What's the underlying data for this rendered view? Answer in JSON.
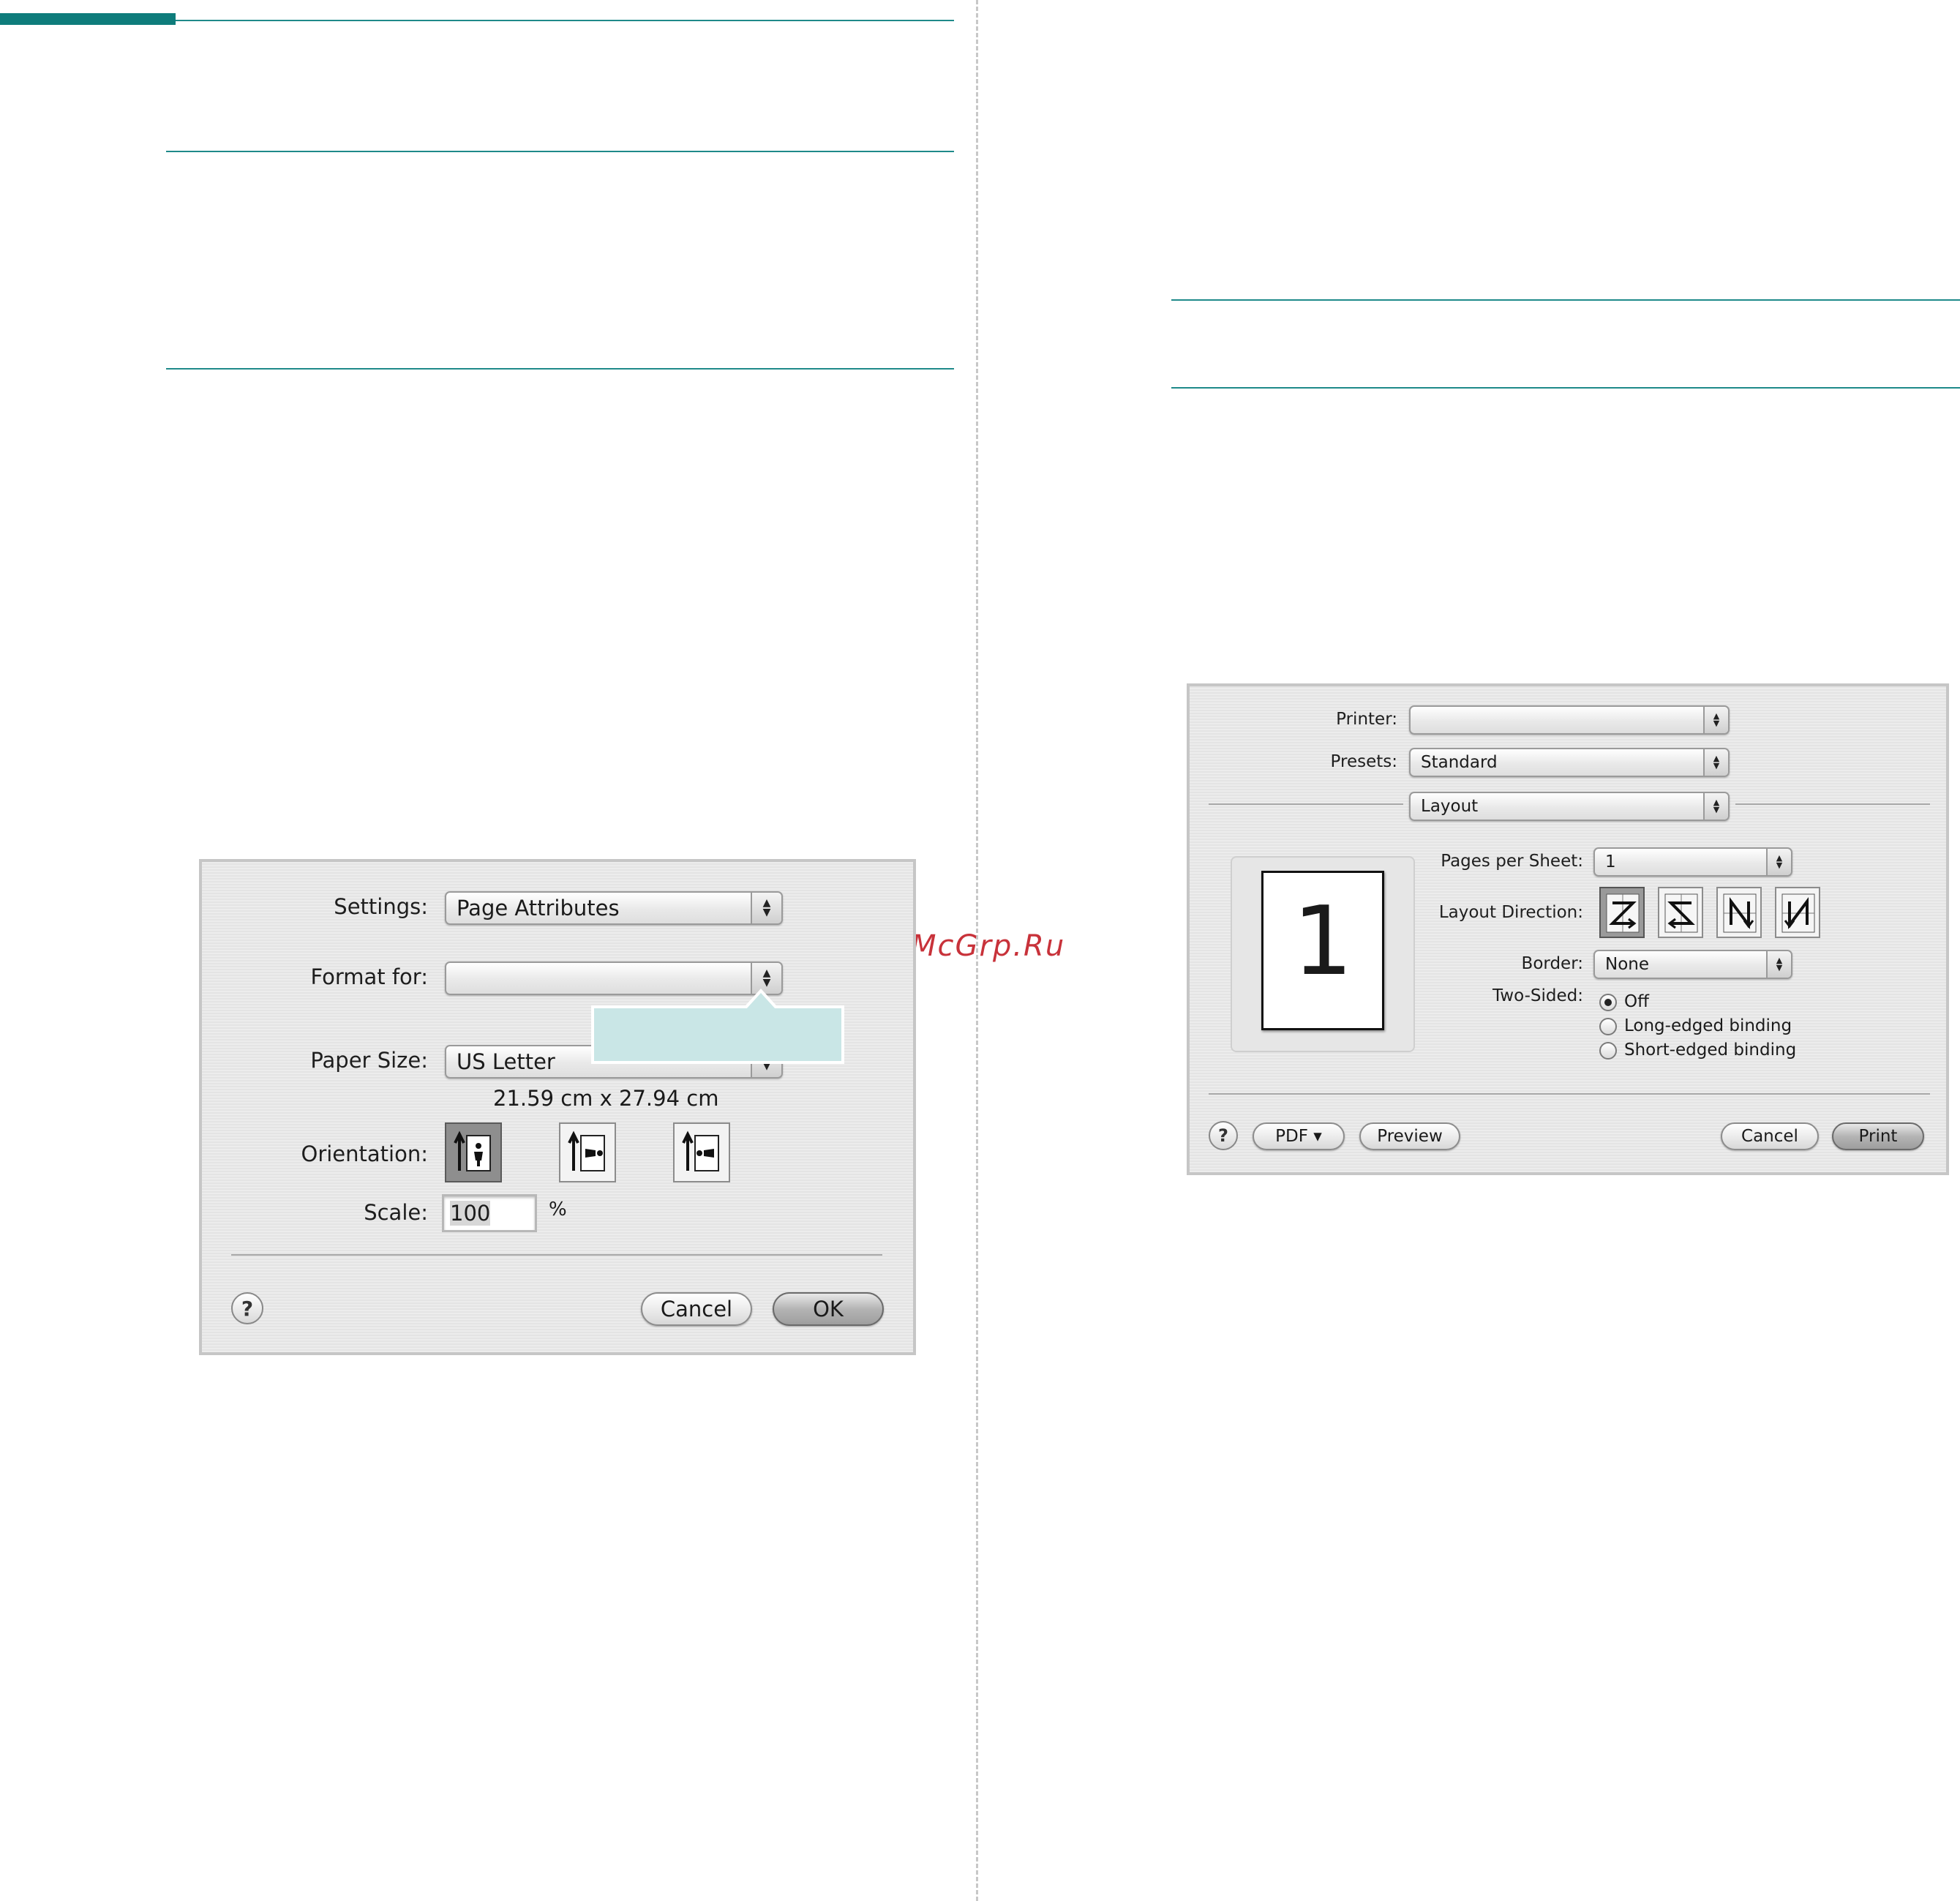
{
  "watermark": "McGrp.Ru",
  "page_setup_dialog": {
    "settings_label": "Settings:",
    "settings_value": "Page Attributes",
    "format_for_label": "Format for:",
    "format_for_value": "",
    "paper_size_label": "Paper Size:",
    "paper_size_value": "US Letter",
    "paper_dimensions": "21.59 cm x 27.94 cm",
    "orientation_label": "Orientation:",
    "orientation_options": [
      "portrait-icon",
      "landscape-icon",
      "landscape-reverse-icon"
    ],
    "orientation_selected": 0,
    "scale_label": "Scale:",
    "scale_value": "100",
    "scale_unit": "%",
    "help_label": "?",
    "cancel_label": "Cancel",
    "ok_label": "OK",
    "callout_color": "#c9e6e6"
  },
  "print_dialog": {
    "printer_label": "Printer:",
    "printer_value": "",
    "presets_label": "Presets:",
    "presets_value": "Standard",
    "panel_value": "Layout",
    "preview_page_number": "1",
    "pages_per_sheet_label": "Pages per Sheet:",
    "pages_per_sheet_value": "1",
    "layout_direction_label": "Layout Direction:",
    "layout_direction_options": [
      "z-order-icon",
      "reverse-z-order-icon",
      "n-order-icon",
      "reverse-n-order-icon"
    ],
    "layout_direction_selected": 0,
    "border_label": "Border:",
    "border_value": "None",
    "two_sided_label": "Two-Sided:",
    "two_sided_options": [
      "Off",
      "Long-edged binding",
      "Short-edged binding"
    ],
    "two_sided_selected": 0,
    "help_label": "?",
    "pdf_label": "PDF ▾",
    "preview_label": "Preview",
    "cancel_label": "Cancel",
    "print_label": "Print"
  },
  "colors": {
    "accent_rule": "#1f8a8a",
    "accent_bar": "#0e7c7b",
    "watermark": "#c8323a"
  }
}
